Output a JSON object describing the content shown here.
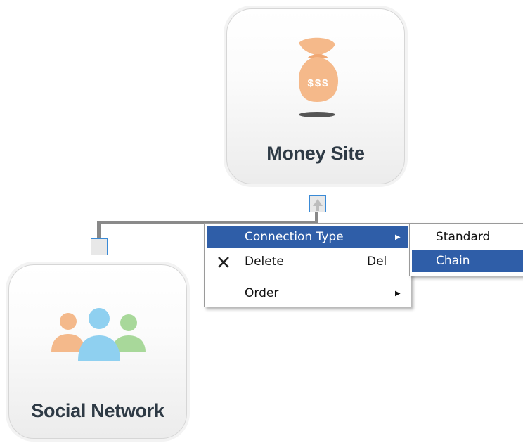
{
  "nodes": {
    "money_site": {
      "label": "Money Site",
      "icon": "money-bag-icon",
      "icon_text": "$$$"
    },
    "social_network": {
      "label": "Social Network",
      "icon": "people-group-icon"
    }
  },
  "context_menu": {
    "items": [
      {
        "label": "Connection Type",
        "submenu": true,
        "highlighted": true
      },
      {
        "label": "Delete",
        "shortcut": "Del",
        "icon": "close-icon"
      },
      {
        "label": "Order",
        "submenu": true
      }
    ]
  },
  "submenu": {
    "items": [
      {
        "label": "Standard"
      },
      {
        "label": "Chain",
        "highlighted": true
      }
    ]
  },
  "colors": {
    "menu_highlight": "#2f5ea8",
    "money_bag": "#f5b98a",
    "person_orange": "#f4b98b",
    "person_blue": "#8fd0f0",
    "person_green": "#a8d89a",
    "label_text": "#2e3a45"
  }
}
